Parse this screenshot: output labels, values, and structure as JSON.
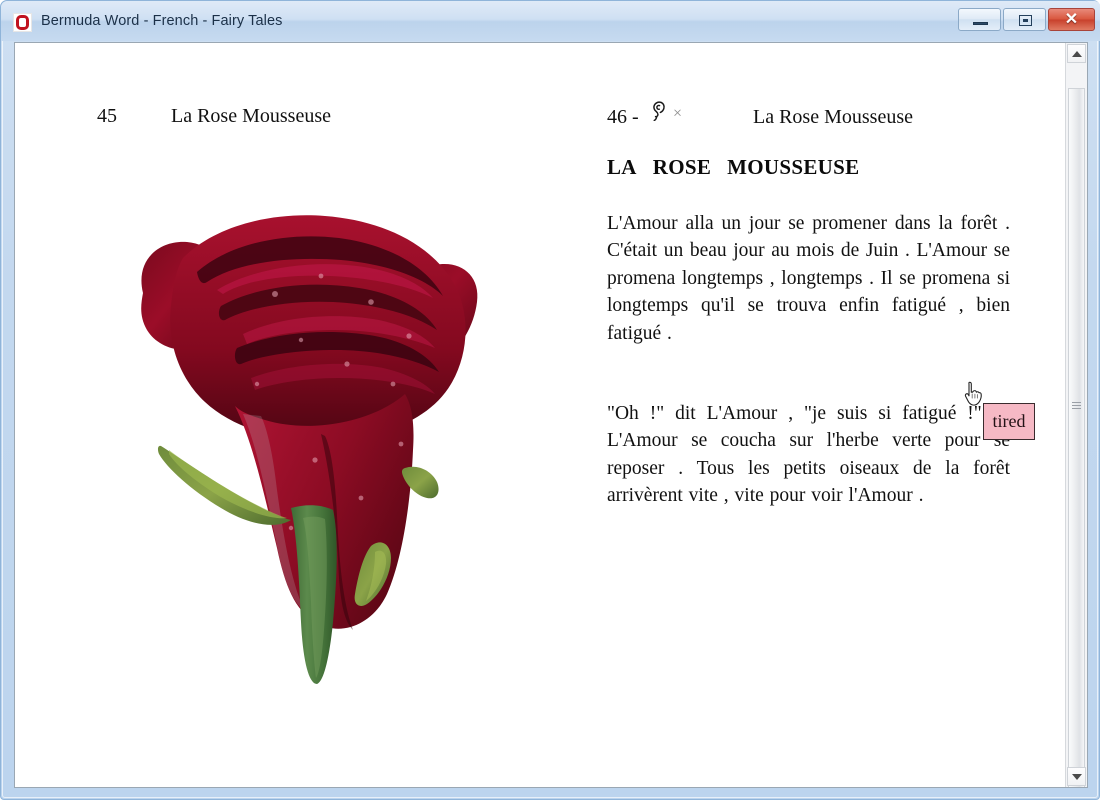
{
  "window": {
    "title": "Bermuda Word - French - Fairy Tales",
    "app_icon": "bermuda-word-icon",
    "controls": {
      "minimize_label": "—",
      "maximize_label": "□",
      "close_label": "✕"
    }
  },
  "book": {
    "left_page": {
      "page_number": "45",
      "chapter_title": "La Rose Mousseuse",
      "illustration": "red-rose-illustration"
    },
    "right_page": {
      "page_number": "46 -",
      "audio_icon": "ear-listen-icon",
      "close_icon": "×",
      "chapter_title": "La Rose Mousseuse",
      "story_title_words": [
        "LA",
        "ROSE",
        "MOUSSEUSE"
      ],
      "paragraphs": [
        "L'Amour alla un jour se promener dans la forêt . C'était un beau jour au mois de Juin . L'Amour se promena longtemps , longtemps . Il se promena si longtemps qu'il se trouva enfin fatigué , bien fatigué .",
        "\"Oh !\" dit L'Amour , \"je suis si fatigué !\" Et L'Amour se coucha sur l'herbe verte pour se reposer . Tous les petits oiseaux de la forêt arrivèrent vite , vite pour voir l'Amour ."
      ]
    }
  },
  "tooltip": {
    "text": "tired",
    "background_color": "#f6b9c5",
    "border_color": "#3a2b2e"
  },
  "cursor": {
    "type": "pointing-hand"
  },
  "scrollbar": {
    "up_arrow": "scroll-up-arrow",
    "down_arrow": "scroll-down-arrow",
    "thumb": "scroll-thumb"
  },
  "colors": {
    "titlebar_accent": "#cfe0f3",
    "close_button": "#c8412c",
    "rose_petal": "#8b0b22",
    "rose_stem": "#4f7a3f"
  }
}
